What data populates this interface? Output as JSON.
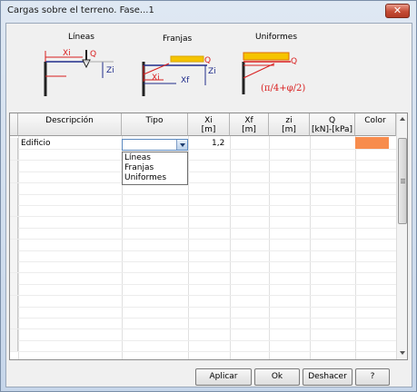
{
  "window": {
    "title": "Cargas sobre el terreno. Fase...1",
    "close_label": "✕"
  },
  "schemes": [
    {
      "label": "Líneas",
      "annotations": [
        "Xi",
        "Q",
        "Zi"
      ]
    },
    {
      "label": "Franjas",
      "annotations": [
        "Q",
        "Zi",
        "Xi",
        "Xf"
      ]
    },
    {
      "label": "Uniformes",
      "annotations": [
        "Q",
        "(π/4+φ/2)"
      ]
    }
  ],
  "table": {
    "headers": [
      {
        "line1": "Descripción",
        "line2": ""
      },
      {
        "line1": "Tipo",
        "line2": ""
      },
      {
        "line1": "Xi",
        "line2": "[m]"
      },
      {
        "line1": "Xf",
        "line2": "[m]"
      },
      {
        "line1": "zi",
        "line2": "[m]"
      },
      {
        "line1": "Q",
        "line2": "[kN]-[kPa]"
      },
      {
        "line1": "Color",
        "line2": ""
      }
    ],
    "rows": [
      {
        "descripcion": "Edificio",
        "tipo": "",
        "xi": "1,2",
        "xf": "",
        "zi": "",
        "q": "",
        "color": "#f78c4d"
      }
    ],
    "tipo_options": [
      "Líneas",
      "Franjas",
      "Uniformes"
    ]
  },
  "buttons": {
    "apply": "Aplicar",
    "ok": "Ok",
    "undo": "Deshacer",
    "help": "?"
  },
  "colors": {
    "accent_orange": "#f78c4d",
    "load_yellow": "#f5c400",
    "red": "#d91e1e"
  }
}
